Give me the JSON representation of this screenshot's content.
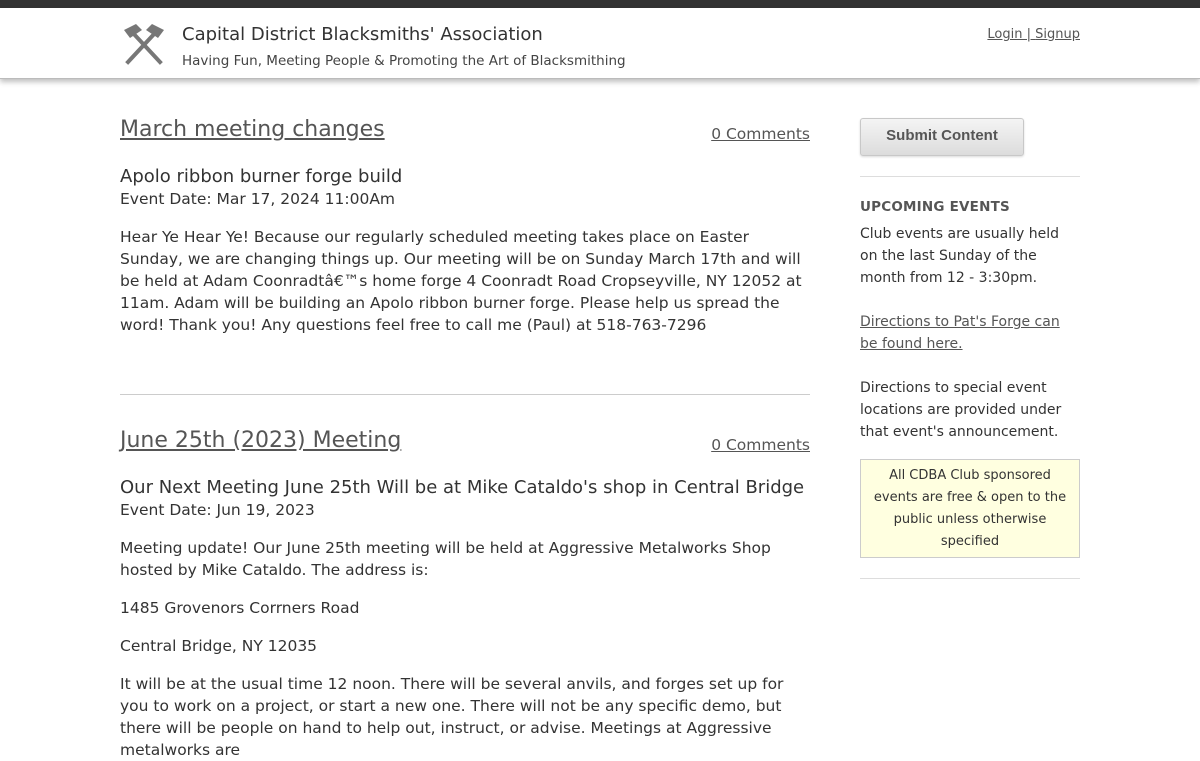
{
  "header": {
    "logo_icon": "crossed-hammers-icon",
    "title": "Capital District Blacksmiths' Association",
    "tagline": "Having Fun, Meeting People & Promoting the Art of Blacksmithing",
    "login_label": "Login",
    "separator": " | ",
    "signup_label": "Signup"
  },
  "posts": [
    {
      "title": "March meeting changes",
      "comments": "0 Comments",
      "event_title": "Apolo ribbon burner forge build",
      "event_date": "Event Date: Mar 17, 2024 11:00Am",
      "paragraphs": [
        "Hear Ye Hear Ye! Because our regularly scheduled meeting takes place on Easter Sunday, we are changing things up. Our meeting will be on Sunday March 17th and will be held at Adam Coonradtâ€™s home forge 4 Coonradt Road Cropseyville, NY 12052 at 11am. Adam will be building an Apolo ribbon burner forge. Please help us spread the word! Thank you! Any questions feel free to call me (Paul) at 518-763-7296"
      ]
    },
    {
      "title": "June 25th (2023) Meeting",
      "comments": "0 Comments",
      "event_title": "Our Next Meeting June 25th Will be at Mike Cataldo's shop in Central Bridge",
      "event_date": "Event Date: Jun 19, 2023",
      "paragraphs": [
        "Meeting update! Our June 25th meeting will be held at Aggressive Metalworks Shop hosted by Mike Cataldo. The address is:",
        "1485 Grovenors Corrners Road",
        "Central Bridge, NY 12035",
        "It will be at the usual time 12 noon. There will be several anvils, and forges set up for you to work on a project, or start a new one. There will not be any specific demo, but there will be people on hand to help out, instruct, or advise. Meetings at Aggressive metalworks are"
      ]
    }
  ],
  "sidebar": {
    "submit_label": "Submit Content",
    "upcoming_heading": "UPCOMING EVENTS",
    "upcoming_text": "Club events are usually held on the last Sunday of the month from 12 - 3:30pm.",
    "directions_link": "Directions to Pat's Forge can be found here.",
    "special_text": "Directions to special event locations are provided under that event's announcement.",
    "notice": "All CDBA Club sponsored events are free & open to the public unless otherwise specified"
  }
}
